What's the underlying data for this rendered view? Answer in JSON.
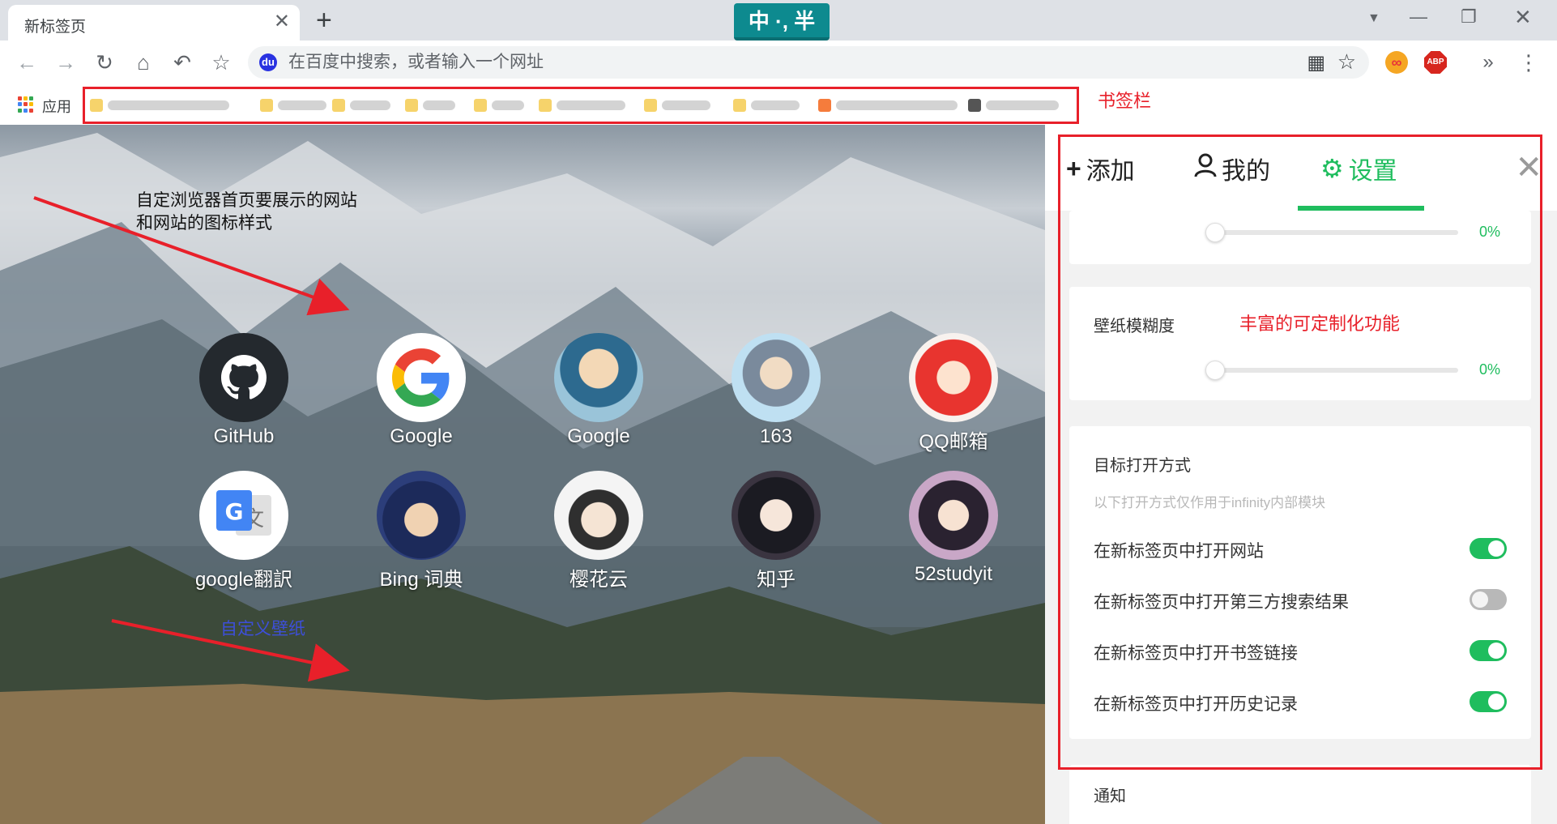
{
  "browser": {
    "tab_title": "新标签页",
    "tab_close": "✕",
    "new_tab": "+",
    "ime_badge": "中 ·, 半",
    "tab_search": "▼",
    "min": "—",
    "max": "❐",
    "close": "✕"
  },
  "toolbar": {
    "back": "←",
    "forward": "→",
    "reload": "↻",
    "home": "⌂",
    "undo": "↶",
    "bookmark_star": "☆",
    "search_placeholder": "在百度中搜索，或者输入一个网址",
    "omni_logo": "du",
    "qr": "▦",
    "omni_star": "☆",
    "ext_infinity": "∞",
    "ext_abp": "ABP",
    "overflow": "»",
    "menu": "⋮"
  },
  "bookmarks_bar": {
    "apps_label": "应用",
    "annotation": "书签栏",
    "apps_colors": [
      "#ea4335",
      "#fbbc05",
      "#34a853",
      "#4285f4",
      "#ea4335",
      "#fbbc05",
      "#34a853",
      "#4285f4",
      "#ea4335"
    ]
  },
  "annotations": {
    "site_style": "自定浏览器首页要展示的网站\n和网站的图标样式",
    "wallpaper": "自定义壁纸",
    "rich_features": "丰富的可定制化功能"
  },
  "sites": [
    {
      "name": "GitHub",
      "icon": "github-icon"
    },
    {
      "name": "Google",
      "icon": "google-icon"
    },
    {
      "name": "Google",
      "icon": "avatar-icon"
    },
    {
      "name": "163",
      "icon": "avatar-icon"
    },
    {
      "name": "QQ邮箱",
      "icon": "avatar-icon"
    },
    {
      "name": "google翻訳",
      "icon": "google-translate-icon"
    },
    {
      "name": "Bing 词典",
      "icon": "avatar-icon"
    },
    {
      "name": "樱花云",
      "icon": "avatar-icon"
    },
    {
      "name": "知乎",
      "icon": "avatar-icon"
    },
    {
      "name": "52studyit",
      "icon": "avatar-icon"
    }
  ],
  "panel": {
    "tabs": {
      "add": "添加",
      "mine": "我的",
      "settings": "设置"
    },
    "close": "✕",
    "slider_top_value": "0%",
    "blur": {
      "label": "壁纸模糊度",
      "value": "0%"
    },
    "open_target": {
      "title": "目标打开方式",
      "hint": "以下打开方式仅作用于infinity内部模块",
      "rows": [
        {
          "label": "在新标签页中打开网站",
          "on": true
        },
        {
          "label": "在新标签页中打开第三方搜索结果",
          "on": false
        },
        {
          "label": "在新标签页中打开书签链接",
          "on": true
        },
        {
          "label": "在新标签页中打开历史记录",
          "on": true
        }
      ]
    },
    "notify_label": "通知"
  },
  "colors": {
    "accent_green": "#1fbd5e",
    "annotation_red": "#e8202a",
    "annotation_blue": "#3d4fd8"
  }
}
